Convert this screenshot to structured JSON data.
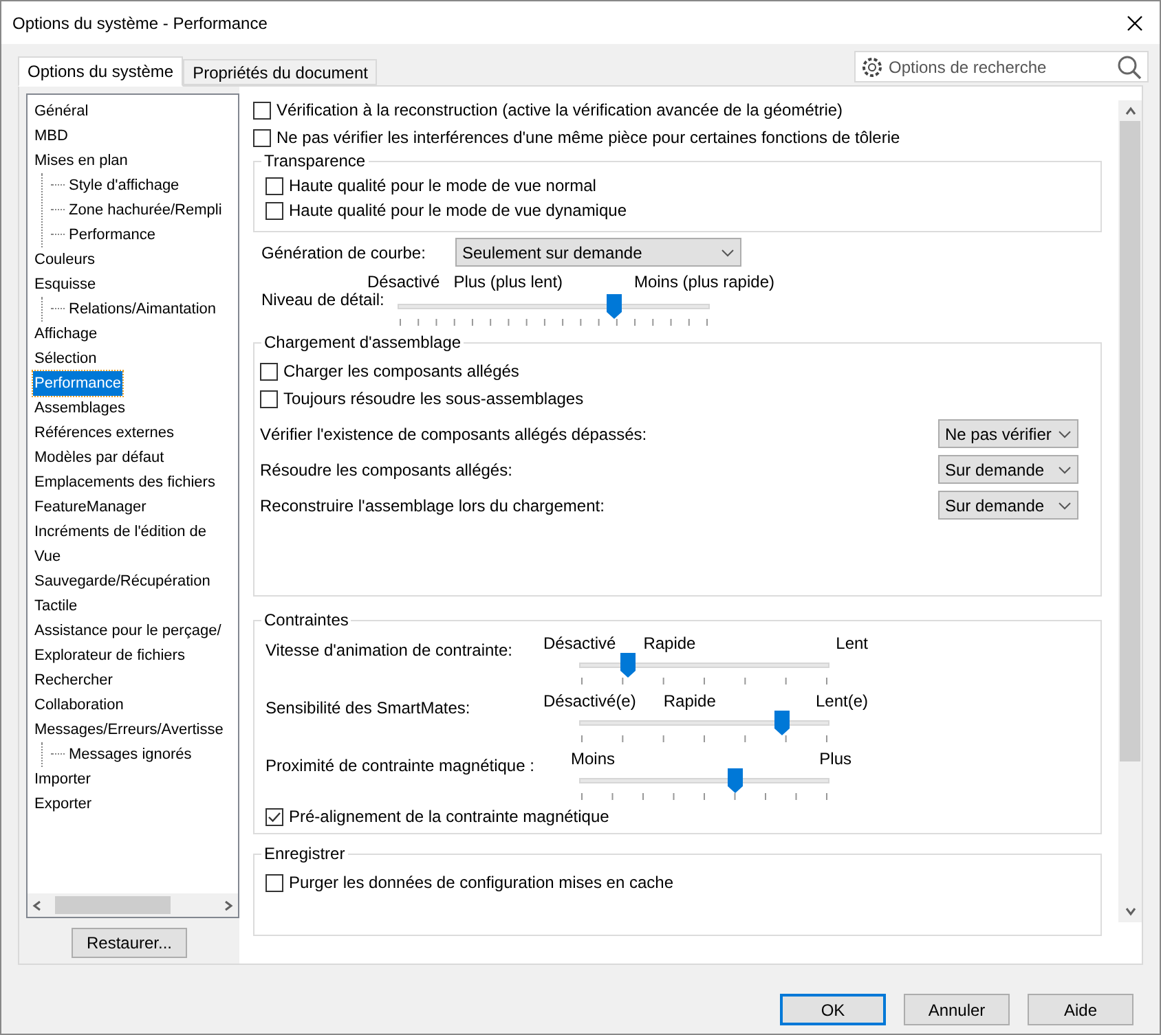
{
  "window": {
    "title": "Options du système - Performance"
  },
  "tabs": [
    {
      "label": "Options du système",
      "selected": true
    },
    {
      "label": "Propriétés du document",
      "selected": false
    }
  ],
  "search": {
    "placeholder": "Options de recherche"
  },
  "tree": [
    {
      "label": "Général",
      "selected": false
    },
    {
      "label": "MBD",
      "selected": false
    },
    {
      "label": "Mises en plan",
      "selected": false,
      "children": [
        {
          "label": "Style d'affichage",
          "selected": false
        },
        {
          "label": "Zone hachurée/Rempli",
          "selected": false
        },
        {
          "label": "Performance",
          "selected": false
        }
      ]
    },
    {
      "label": "Couleurs",
      "selected": false
    },
    {
      "label": "Esquisse",
      "selected": false,
      "children": [
        {
          "label": "Relations/Aimantation",
          "selected": false
        }
      ]
    },
    {
      "label": "Affichage",
      "selected": false
    },
    {
      "label": "Sélection",
      "selected": false
    },
    {
      "label": "Performance",
      "selected": true
    },
    {
      "label": "Assemblages",
      "selected": false
    },
    {
      "label": "Références externes",
      "selected": false
    },
    {
      "label": "Modèles par défaut",
      "selected": false
    },
    {
      "label": "Emplacements des fichiers",
      "selected": false
    },
    {
      "label": "FeatureManager",
      "selected": false
    },
    {
      "label": "Incréments de l'édition de",
      "selected": false
    },
    {
      "label": "Vue",
      "selected": false
    },
    {
      "label": "Sauvegarde/Récupération",
      "selected": false
    },
    {
      "label": "Tactile",
      "selected": false
    },
    {
      "label": "Assistance pour le perçage/",
      "selected": false
    },
    {
      "label": "Explorateur de fichiers",
      "selected": false
    },
    {
      "label": "Rechercher",
      "selected": false
    },
    {
      "label": "Collaboration",
      "selected": false
    },
    {
      "label": "Messages/Erreurs/Avertisse",
      "selected": false,
      "children": [
        {
          "label": "Messages ignorés",
          "selected": false
        }
      ]
    },
    {
      "label": "Importer",
      "selected": false
    },
    {
      "label": "Exporter",
      "selected": false
    }
  ],
  "restore_button": "Restaurer...",
  "options": [
    {
      "label": "Vérification à la reconstruction (active la vérification avancée de la géométrie)",
      "checked": false
    },
    {
      "label": "Ne pas vérifier les interférences d'une même pièce pour certaines fonctions de tôlerie",
      "checked": false
    }
  ],
  "transparence": {
    "title": "Transparence",
    "options": [
      {
        "label": "Haute qualité pour le mode de vue normal",
        "checked": false
      },
      {
        "label": "Haute qualité pour le mode de vue dynamique",
        "checked": false
      }
    ]
  },
  "curve": {
    "label": "Génération de courbe:",
    "value": "Seulement sur demande"
  },
  "detail": {
    "label": "Niveau de détail:",
    "scale_labels": [
      "Désactivé",
      "Plus (plus lent)",
      "Moins (plus rapide)"
    ],
    "level": 0.69
  },
  "assembly": {
    "title": "Chargement d'assemblage",
    "options": [
      {
        "label": "Charger les composants allégés",
        "checked": false
      },
      {
        "label": "Toujours résoudre les sous-assemblages",
        "checked": false
      }
    ],
    "dropdowns": [
      {
        "label": "Vérifier l'existence de composants allégés dépassés:",
        "value": "Ne pas vérifier"
      },
      {
        "label": "Résoudre les composants allégés:",
        "value": "Sur demande"
      },
      {
        "label": "Reconstruire l'assemblage lors du chargement:",
        "value": "Sur demande"
      }
    ]
  },
  "mates": {
    "title": "Contraintes",
    "sliders": [
      {
        "label": "Vitesse d'animation de contrainte:",
        "scale_labels": [
          "Désactivé",
          "Rapide",
          "Lent"
        ],
        "level": 0.19
      },
      {
        "label": "Sensibilité des SmartMates:",
        "scale_labels": [
          "Désactivé(e)",
          "Rapide",
          "Lent(e)"
        ],
        "level": 0.81
      },
      {
        "label": "Proximité de contrainte magnétique :",
        "scale_labels": [
          "Moins",
          "Plus"
        ],
        "level": 0.62
      }
    ],
    "options": [
      {
        "label": "Pré-alignement de la contrainte magnétique",
        "checked": true
      }
    ]
  },
  "save": {
    "title": "Enregistrer",
    "options": [
      {
        "label": "Purger les données de configuration mises en cache",
        "checked": false
      }
    ]
  },
  "buttons": [
    {
      "label": "OK",
      "default": true
    },
    {
      "label": "Annuler",
      "default": false
    },
    {
      "label": "Aide",
      "default": false
    }
  ]
}
